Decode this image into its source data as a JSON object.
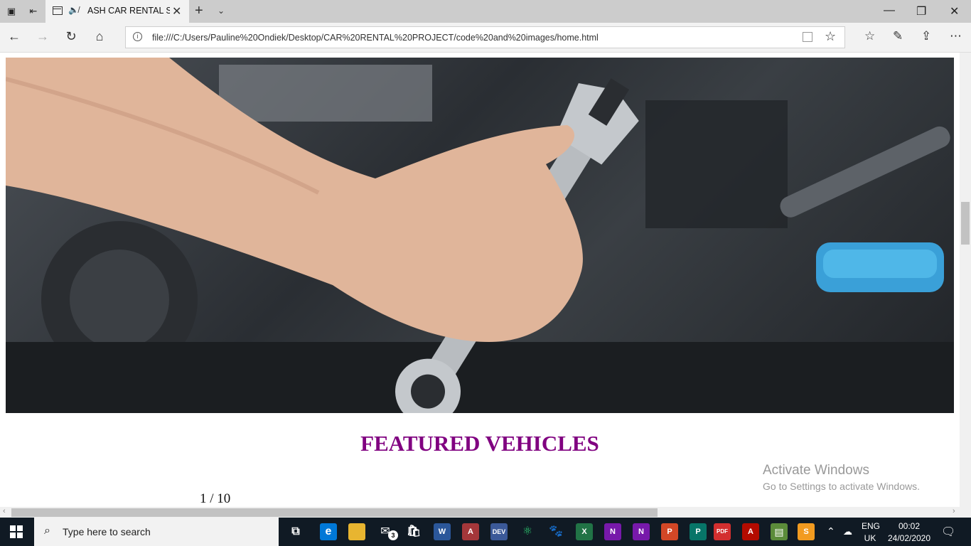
{
  "browser": {
    "tab_title": "ASH CAR RENTAL S",
    "url": "file:///C:/Users/Pauline%20Ondiek/Desktop/CAR%20RENTAL%20PROJECT/code%20and%20images/home.html"
  },
  "page": {
    "heading": "FEATURED VEHICLES",
    "slide_counter": "1 / 10",
    "hero_image_alt": "hand-holding-wrench-over-engine"
  },
  "watermark": {
    "line1": "Activate Windows",
    "line2": "Go to Settings to activate Windows."
  },
  "taskbar": {
    "search_placeholder": "Type here to search",
    "mail_badge": "3",
    "lang_top": "ENG",
    "lang_bottom": "UK",
    "time": "00:02",
    "date": "24/02/2020"
  },
  "colors": {
    "heading": "#800080",
    "taskbar": "#101a24"
  }
}
